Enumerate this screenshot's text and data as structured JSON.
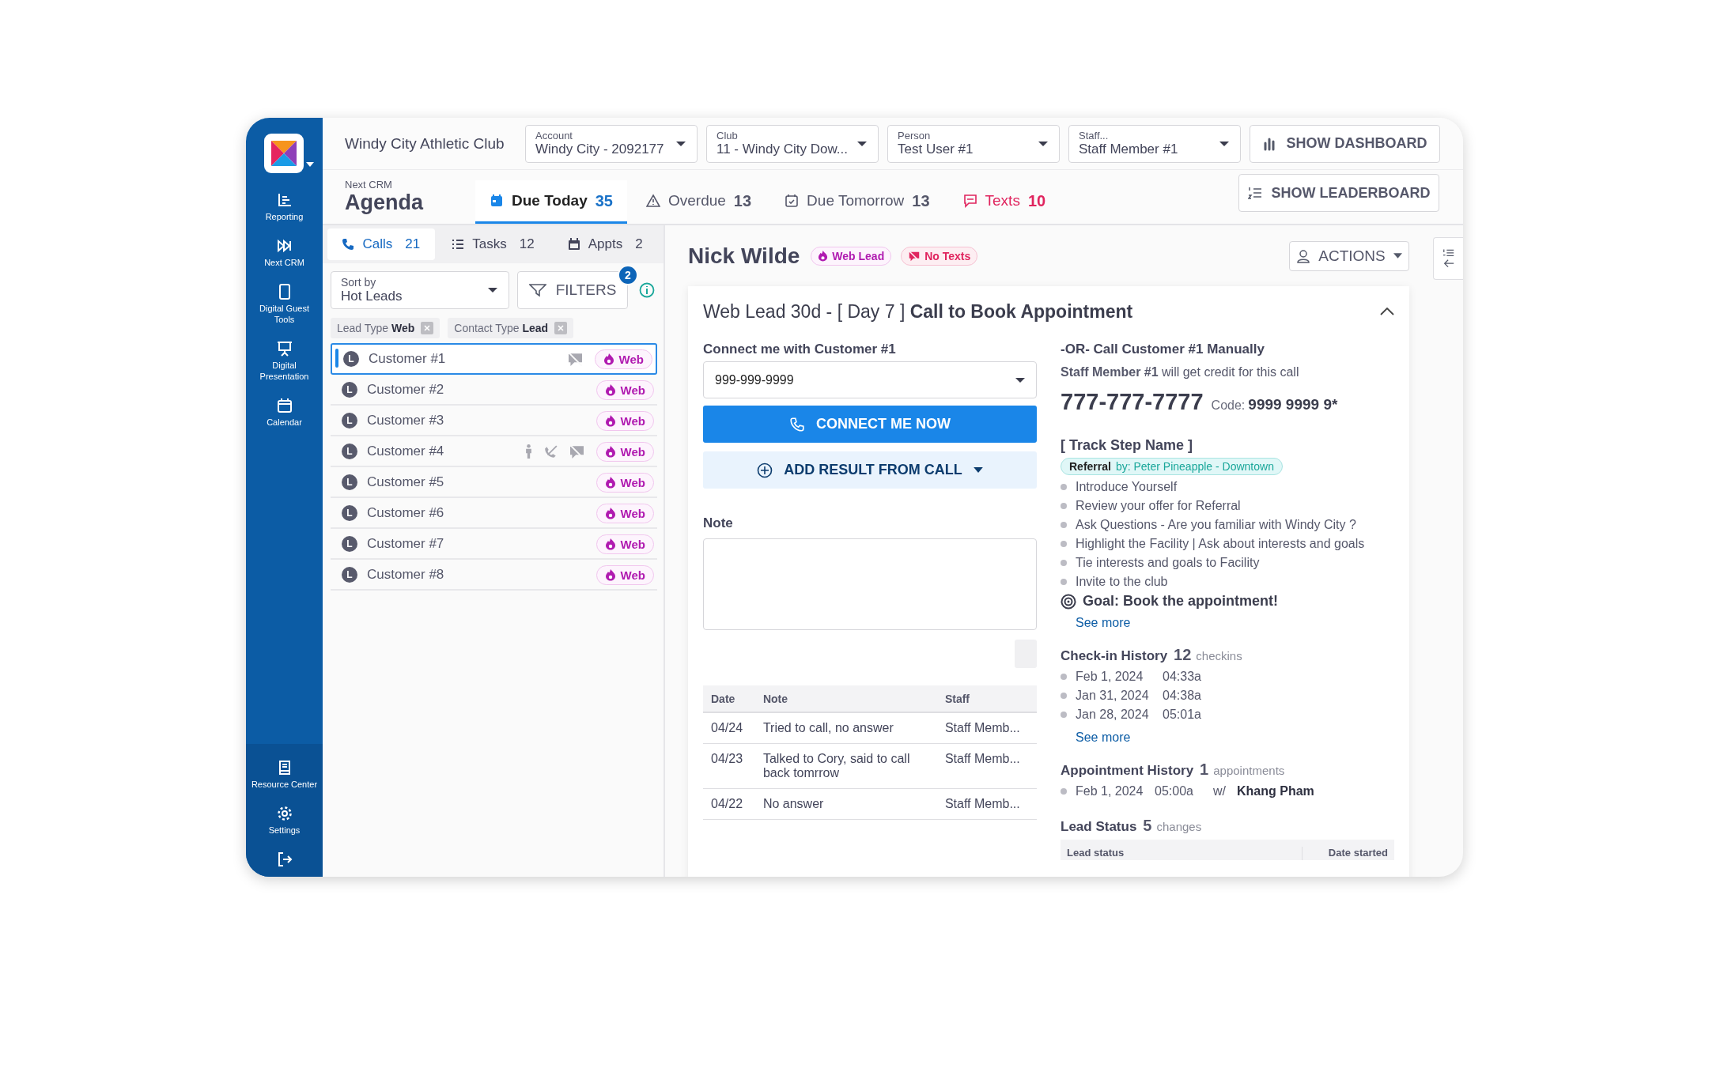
{
  "sidebar": {
    "items": [
      {
        "label": "Reporting"
      },
      {
        "label": "Next CRM"
      },
      {
        "label": "Digital Guest Tools"
      },
      {
        "label": "Digital Presentation"
      },
      {
        "label": "Calendar"
      }
    ],
    "bottom_items": [
      {
        "label": "Resource Center"
      },
      {
        "label": "Settings"
      }
    ]
  },
  "header": {
    "club_name": "Windy City Athletic Club",
    "selects": [
      {
        "label": "Account",
        "value": "Windy City - 2092177"
      },
      {
        "label": "Club",
        "value": "11 - Windy City Dow..."
      },
      {
        "label": "Person",
        "value": "Test User #1"
      },
      {
        "label": "Staff...",
        "value": "Staff Member #1"
      }
    ],
    "dashboard_button": "SHOW DASHBOARD"
  },
  "agenda": {
    "subtitle": "Next CRM",
    "title": "Agenda",
    "tabs": [
      {
        "kind": "today",
        "label": "Due Today",
        "count": "35",
        "selected": true
      },
      {
        "kind": "overdue",
        "label": "Overdue",
        "count": "13",
        "selected": false
      },
      {
        "kind": "tomorrow",
        "label": "Due Tomorrow",
        "count": "13",
        "selected": false
      },
      {
        "kind": "texts",
        "label": "Texts",
        "count": "10",
        "selected": false
      }
    ],
    "leaderboard_button": "SHOW LEADERBOARD"
  },
  "list_tabs": [
    {
      "kind": "calls",
      "label": "Calls",
      "count": "21",
      "selected": true
    },
    {
      "kind": "tasks",
      "label": "Tasks",
      "count": "12",
      "selected": false
    },
    {
      "kind": "appts",
      "label": "Appts",
      "count": "2",
      "selected": false
    }
  ],
  "sort": {
    "label": "Sort by",
    "value": "Hot Leads"
  },
  "filters": {
    "label": "FILTERS",
    "badge": "2"
  },
  "chips": [
    {
      "name": "Lead Type",
      "value": "Web"
    },
    {
      "name": "Contact Type",
      "value": "Lead"
    }
  ],
  "customers": [
    {
      "initial": "L",
      "name": "Customer #1",
      "selected": true,
      "person": false,
      "no_calls": false,
      "no_texts": true,
      "tag": "Web"
    },
    {
      "initial": "L",
      "name": "Customer #2",
      "selected": false,
      "person": false,
      "no_calls": false,
      "no_texts": false,
      "tag": "Web"
    },
    {
      "initial": "L",
      "name": "Customer #3",
      "selected": false,
      "person": false,
      "no_calls": false,
      "no_texts": false,
      "tag": "Web"
    },
    {
      "initial": "L",
      "name": "Customer #4",
      "selected": false,
      "person": true,
      "no_calls": true,
      "no_texts": true,
      "tag": "Web"
    },
    {
      "initial": "L",
      "name": "Customer #5",
      "selected": false,
      "person": false,
      "no_calls": false,
      "no_texts": false,
      "tag": "Web"
    },
    {
      "initial": "L",
      "name": "Customer #6",
      "selected": false,
      "person": false,
      "no_calls": false,
      "no_texts": false,
      "tag": "Web"
    },
    {
      "initial": "L",
      "name": "Customer #7",
      "selected": false,
      "person": false,
      "no_calls": false,
      "no_texts": false,
      "tag": "Web"
    },
    {
      "initial": "L",
      "name": "Customer #8",
      "selected": false,
      "person": false,
      "no_calls": false,
      "no_texts": false,
      "tag": "Web"
    }
  ],
  "contact": {
    "name": "Nick Wilde",
    "badges": [
      {
        "kind": "web",
        "label": "Web Lead"
      },
      {
        "kind": "no-texts",
        "label": "No Texts"
      }
    ],
    "actions_button": "ACTIONS"
  },
  "task": {
    "title": "Web Lead 30d - [ Day 7 ] **Call to Book Appointment**",
    "connect_label": "Connect me with Customer #1",
    "phone_select": "999-999-9999",
    "connect_button": "CONNECT ME NOW",
    "add_result_button": "ADD RESULT FROM CALL",
    "note_label": "Note",
    "notes_table": {
      "columns": [
        "Date",
        "Note",
        "Staff"
      ],
      "rows": [
        [
          "04/24",
          "Tried to call, no answer",
          "Staff Memb..."
        ],
        [
          "04/23",
          "Talked to Cory, said to call back tomrrow",
          "Staff Memb..."
        ],
        [
          "04/22",
          "No answer",
          "Staff Memb..."
        ]
      ]
    },
    "manual": {
      "title": "-OR- Call Customer #1 Manually",
      "credit": "**Staff Member #1** will get credit for this call",
      "phone": "777-777-7777",
      "code_label": "Code:",
      "code": "9999 9999 9*"
    },
    "track": {
      "title": "[ Track Step Name ]",
      "referral_label": "Referral",
      "referral_by": "by: Peter Pineapple - Downtown",
      "steps": [
        "Introduce Yourself",
        "Review your offer for Referral",
        "Ask Questions - Are you familiar with Windy City ?",
        "Highlight the Facility | Ask about interests and goals",
        "Tie interests and goals to Facility",
        "Invite to the club"
      ],
      "goal": "Goal: Book the appointment!",
      "see_more": "See more"
    },
    "checkins": {
      "title": "Check-in History",
      "count": "12",
      "unit": "checkins",
      "items": [
        {
          "date": "Feb 1, 2024",
          "time": "04:33a"
        },
        {
          "date": "Jan 31, 2024",
          "time": "04:38a"
        },
        {
          "date": "Jan 28, 2024",
          "time": "05:01a"
        }
      ],
      "see_more": "See more"
    },
    "appointments": {
      "title": "Appointment History",
      "count": "1",
      "unit": "appointments",
      "items": [
        {
          "date": "Feb 1, 2024",
          "time": "05:00a",
          "with": "w/",
          "staff": "Khang Pham"
        }
      ]
    },
    "lead_status": {
      "title": "Lead Status",
      "count": "5",
      "unit": "changes",
      "columns": [
        "Lead status",
        "Date started"
      ]
    }
  }
}
